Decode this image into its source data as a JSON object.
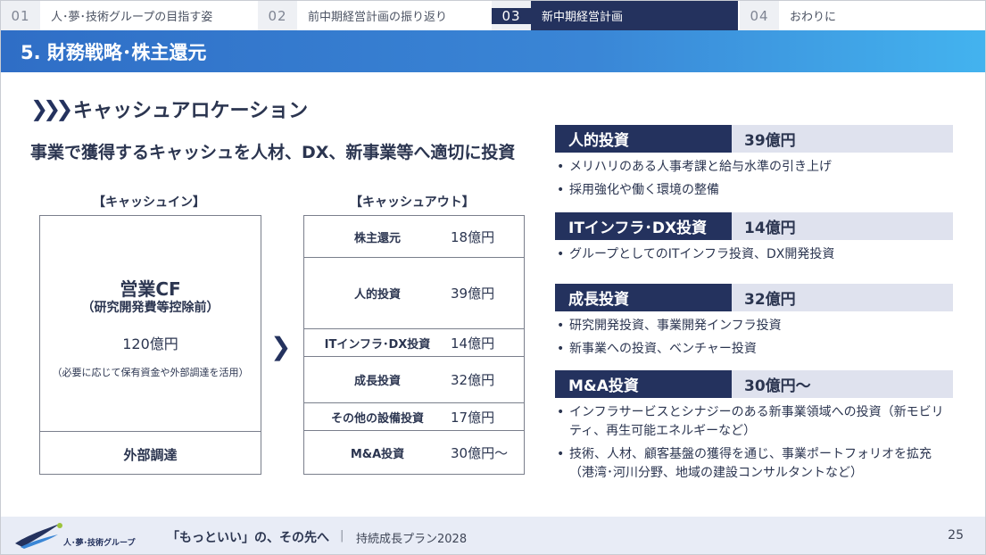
{
  "tabs": [
    {
      "num": "01",
      "label": "人･夢･技術グループの目指す姿"
    },
    {
      "num": "02",
      "label": "前中期経営計画の振り返り"
    },
    {
      "num": "03",
      "label": "新中期経営計画"
    },
    {
      "num": "04",
      "label": "おわりに"
    }
  ],
  "banner_title": "5. 財務戦略･株主還元",
  "section_heading": "キャッシュアロケーション",
  "lead": "事業で獲得するキャッシュを人材、DX、新事業等へ適切に投資",
  "cash_in": {
    "label": "【キャッシュイン】",
    "title": "営業CF",
    "subtitle": "（研究開発費等控除前）",
    "amount": "120億円",
    "note": "（必要に応じて保有資金や外部調達を活用）",
    "external": "外部調達"
  },
  "cash_out": {
    "label": "【キャッシュアウト】",
    "rows": [
      {
        "name": "株主還元",
        "value": "18億円"
      },
      {
        "name": "人的投資",
        "value": "39億円"
      },
      {
        "name": "ITインフラ･DX投資",
        "value": "14億円"
      },
      {
        "name": "成長投資",
        "value": "32億円"
      },
      {
        "name": "その他の設備投資",
        "value": "17億円"
      },
      {
        "name": "M&A投資",
        "value": "30億円〜"
      }
    ]
  },
  "investments": [
    {
      "name": "人的投資",
      "amount": "39億円",
      "bullets": [
        "メリハリのある人事考課と給与水準の引き上げ",
        "採用強化や働く環境の整備"
      ]
    },
    {
      "name": "ITインフラ･DX投資",
      "amount": "14億円",
      "bullets": [
        "グループとしてのITインフラ投資、DX開発投資"
      ]
    },
    {
      "name": "成長投資",
      "amount": "32億円",
      "bullets": [
        "研究開発投資、事業開発インフラ投資",
        "新事業への投資、ベンチャー投資"
      ]
    },
    {
      "name": "M&A投資",
      "amount": "30億円〜",
      "bullets": [
        "インフラサービスとシナジーのある新事業領域への投資（新モビリティ、再生可能エネルギーなど）",
        "技術、人材、顧客基盤の獲得を通じ、事業ポートフォリオを拡充（港湾･河川分野、地域の建設コンサルタントなど）"
      ]
    }
  ],
  "footer": {
    "logo_text": "人･夢･技術グループ",
    "tagline": "「もっといい」の、その先へ",
    "divider": "|",
    "plan": "持続成長プラン2028",
    "page_number": "25"
  },
  "colors": {
    "navy": "#24325e",
    "banner_start": "#2f6ec6",
    "banner_end": "#43b3ef",
    "amount_bg": "#dfe2ee"
  }
}
